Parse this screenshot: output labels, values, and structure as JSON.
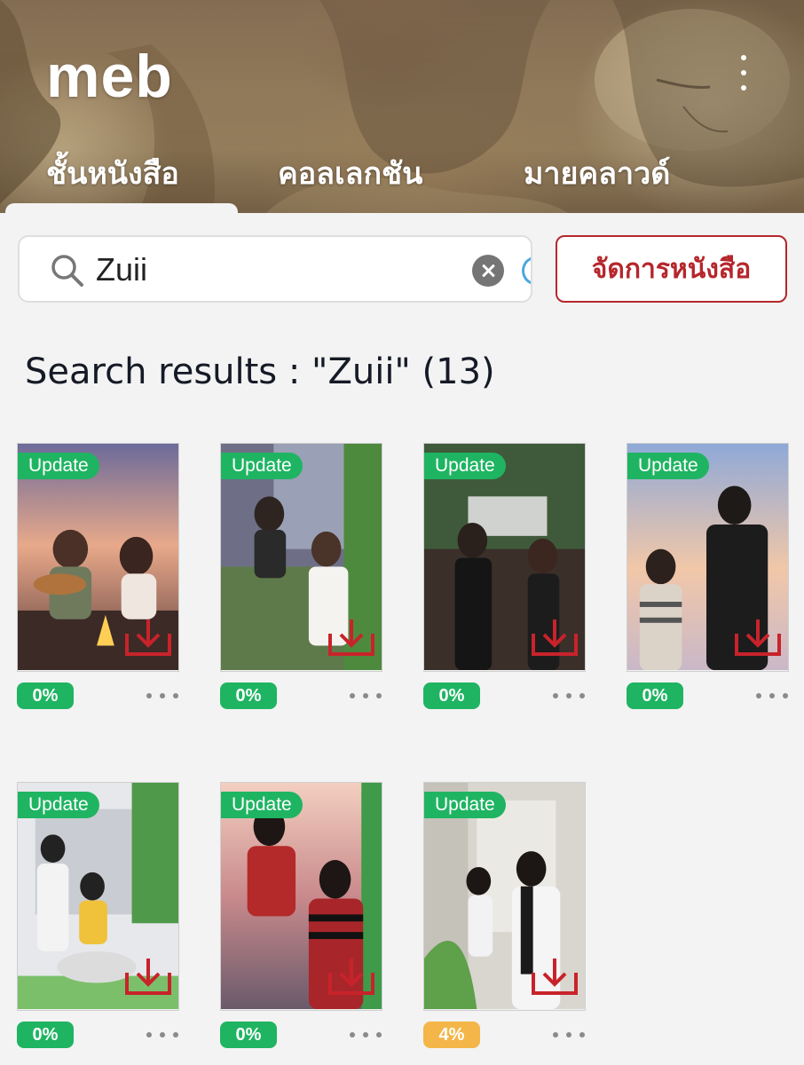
{
  "header": {
    "logo": "meb",
    "tabs": [
      {
        "label": "ชั้นหนังสือ",
        "active": true
      },
      {
        "label": "คอลเลกชัน",
        "active": false
      },
      {
        "label": "มายคลาวด์",
        "active": false
      }
    ],
    "menu_icon": "vertical-ellipsis-icon"
  },
  "search": {
    "value": "Zuii",
    "clear_icon": "clear-icon"
  },
  "manage_button": "จัดการหนังสือ",
  "results_title": "Search results : \"Zuii\" (13)",
  "colors": {
    "accent_red": "#b5262c",
    "badge_green": "#1fb462",
    "badge_yellow": "#f4b648"
  },
  "books": [
    {
      "badge": "Update",
      "progress": "0%"
    },
    {
      "badge": "Update",
      "progress": "0%"
    },
    {
      "badge": "Update",
      "progress": "0%"
    },
    {
      "badge": "Update",
      "progress": "0%"
    },
    {
      "badge": "Update",
      "progress": "0%"
    },
    {
      "badge": "Update",
      "progress": "0%"
    },
    {
      "badge": "Update",
      "progress": "4%"
    }
  ]
}
